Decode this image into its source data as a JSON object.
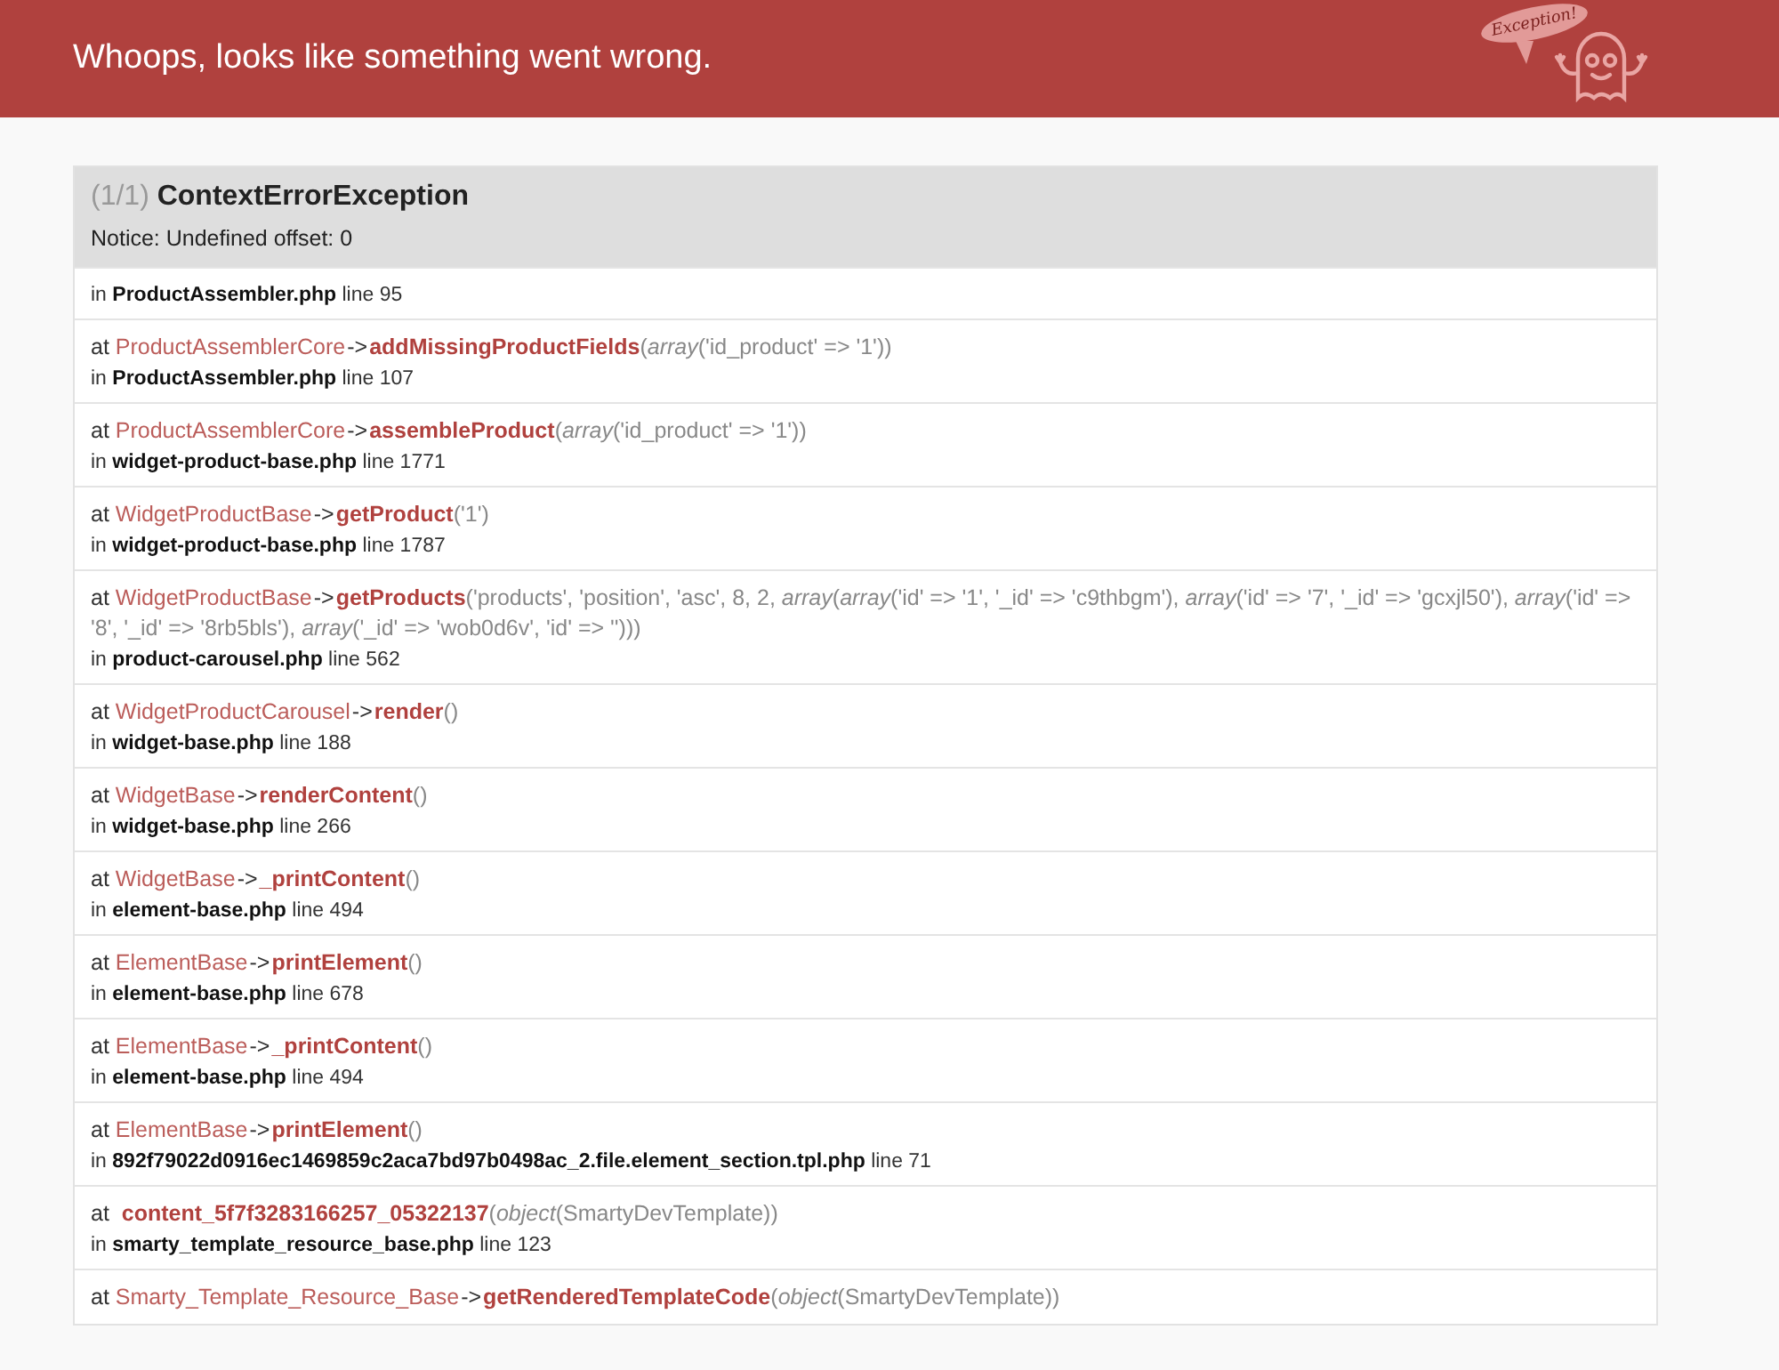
{
  "header": {
    "title": "Whoops, looks like something went wrong.",
    "logo_text": "Exception!"
  },
  "exception": {
    "counter": "(1/1)",
    "name": "ContextErrorException",
    "message": "Notice: Undefined offset: 0"
  },
  "frames": [
    {
      "location": {
        "in": "in",
        "file": "ProductAssembler.php",
        "line": "line 95"
      }
    },
    {
      "call": {
        "at": "at",
        "class": "ProductAssemblerCore",
        "arrow": "->",
        "method": "addMissingProductFields",
        "args": "(*array*('id_product' => '1'))"
      },
      "location": {
        "in": "in",
        "file": "ProductAssembler.php",
        "line": "line 107"
      }
    },
    {
      "call": {
        "at": "at",
        "class": "ProductAssemblerCore",
        "arrow": "->",
        "method": "assembleProduct",
        "args": "(*array*('id_product' => '1'))"
      },
      "location": {
        "in": "in",
        "file": "widget-product-base.php",
        "line": "line 1771"
      }
    },
    {
      "call": {
        "at": "at",
        "class": "WidgetProductBase",
        "arrow": "->",
        "method": "getProduct",
        "args": "('1')"
      },
      "location": {
        "in": "in",
        "file": "widget-product-base.php",
        "line": "line 1787"
      }
    },
    {
      "call": {
        "at": "at",
        "class": "WidgetProductBase",
        "arrow": "->",
        "method": "getProducts",
        "args": "('products', 'position', 'asc', 8, 2, *array*(*array*('id' => '1', '_id' => 'c9thbgm'), *array*('id' => '7', '_id' => 'gcxjl50'), *array*('id' => '8', '_id' => '8rb5bls'), *array*('_id' => 'wob0d6v', 'id' => '')))"
      },
      "location": {
        "in": "in",
        "file": "product-carousel.php",
        "line": "line 562"
      }
    },
    {
      "call": {
        "at": "at",
        "class": "WidgetProductCarousel",
        "arrow": "->",
        "method": "render",
        "args": "()"
      },
      "location": {
        "in": "in",
        "file": "widget-base.php",
        "line": "line 188"
      }
    },
    {
      "call": {
        "at": "at",
        "class": "WidgetBase",
        "arrow": "->",
        "method": "renderContent",
        "args": "()"
      },
      "location": {
        "in": "in",
        "file": "widget-base.php",
        "line": "line 266"
      }
    },
    {
      "call": {
        "at": "at",
        "class": "WidgetBase",
        "arrow": "->",
        "method": "_printContent",
        "args": "()"
      },
      "location": {
        "in": "in",
        "file": "element-base.php",
        "line": "line 494"
      }
    },
    {
      "call": {
        "at": "at",
        "class": "ElementBase",
        "arrow": "->",
        "method": "printElement",
        "args": "()"
      },
      "location": {
        "in": "in",
        "file": "element-base.php",
        "line": "line 678"
      }
    },
    {
      "call": {
        "at": "at",
        "class": "ElementBase",
        "arrow": "->",
        "method": "_printContent",
        "args": "()"
      },
      "location": {
        "in": "in",
        "file": "element-base.php",
        "line": "line 494"
      }
    },
    {
      "call": {
        "at": "at",
        "class": "ElementBase",
        "arrow": "->",
        "method": "printElement",
        "args": "()"
      },
      "location": {
        "in": "in",
        "file": "892f79022d0916ec1469859c2aca7bd97b0498ac_2.file.element_section.tpl.php",
        "line": "line 71"
      }
    },
    {
      "call": {
        "at": "at",
        "method": "content_5f7f3283166257_05322137",
        "args": "(*object*(SmartyDevTemplate))"
      },
      "location": {
        "in": "in",
        "file": "smarty_template_resource_base.php",
        "line": "line 123"
      }
    },
    {
      "call": {
        "at": "at",
        "class": "Smarty_Template_Resource_Base",
        "arrow": "->",
        "method": "getRenderedTemplateCode",
        "args": "(*object*(SmartyDevTemplate))"
      }
    }
  ]
}
